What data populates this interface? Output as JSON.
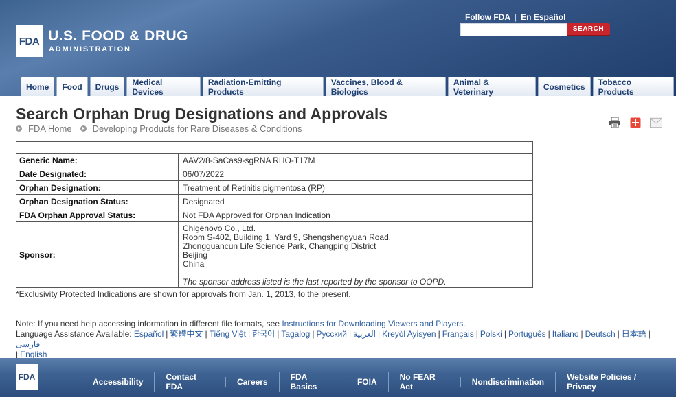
{
  "header": {
    "logo_text": "FDA",
    "title": "U.S. FOOD & DRUG",
    "subtitle": "ADMINISTRATION",
    "follow_link": "Follow FDA",
    "spanish_link": "En Español",
    "separator": "|",
    "search_button": "SEARCH",
    "search_value": ""
  },
  "nav": {
    "tabs": [
      {
        "label": "Home"
      },
      {
        "label": "Food"
      },
      {
        "label": "Drugs"
      },
      {
        "label": "Medical Devices"
      },
      {
        "label": "Radiation-Emitting Products"
      },
      {
        "label": "Vaccines, Blood & Biologics"
      },
      {
        "label": "Animal & Veterinary"
      },
      {
        "label": "Cosmetics"
      },
      {
        "label": "Tobacco Products"
      }
    ],
    "active_tab": "Food"
  },
  "page": {
    "title": "Search Orphan Drug Designations and Approvals",
    "breadcrumb": [
      "FDA Home",
      "Developing Products for Rare Diseases & Conditions"
    ],
    "tools": [
      "print-icon",
      "share-plus-icon",
      "email-icon"
    ]
  },
  "details": {
    "rows": [
      {
        "label": "Generic Name:",
        "value": "AAV2/8-SaCas9-sgRNA RHO-T17M"
      },
      {
        "label": "Date Designated:",
        "value": "06/07/2022"
      },
      {
        "label": "Orphan Designation:",
        "value": "Treatment of Retinitis pigmentosa (RP)"
      },
      {
        "label": "Orphan Designation Status:",
        "value": "Designated"
      },
      {
        "label": "FDA Orphan Approval Status:",
        "value": "Not FDA Approved for Orphan Indication"
      }
    ],
    "sponsor": {
      "label": "Sponsor:",
      "lines": [
        "Chigenovo Co., Ltd.",
        "Room S-402, Building 1, Yard 9, Shengshengyuan Road,",
        "Zhongguancun Life Science Park, Changping District",
        "Beijing",
        "China"
      ],
      "note": "The sponsor address listed is the last reported by the sponsor to OOPD."
    }
  },
  "exclusivity_note": "*Exclusivity Protected Indications are shown for approvals from Jan. 1, 2013, to the present.",
  "help": {
    "prefix": "Note: If you need help accessing information in different file formats, see ",
    "link": "Instructions for Downloading Viewers and Players."
  },
  "languages": {
    "prefix": "Language Assistance Available:",
    "items": [
      "Español",
      "繁體中文",
      "Tiếng Việt",
      "한국어",
      "Tagalog",
      "Русский",
      "العربية",
      "Kreyòl Ayisyen",
      "Français",
      "Polski",
      "Português",
      "Italiano",
      "Deutsch",
      "日本語",
      "فارسی",
      "English"
    ]
  },
  "footer": {
    "logo_text": "FDA",
    "links": [
      "Accessibility",
      "Contact FDA",
      "Careers",
      "FDA Basics",
      "FOIA",
      "No FEAR Act",
      "Nondiscrimination",
      "Website Policies / Privacy"
    ]
  },
  "colors": {
    "header_blue": "#2a4a7a",
    "search_red": "#c8252c",
    "link_blue": "#2c5ea0"
  }
}
